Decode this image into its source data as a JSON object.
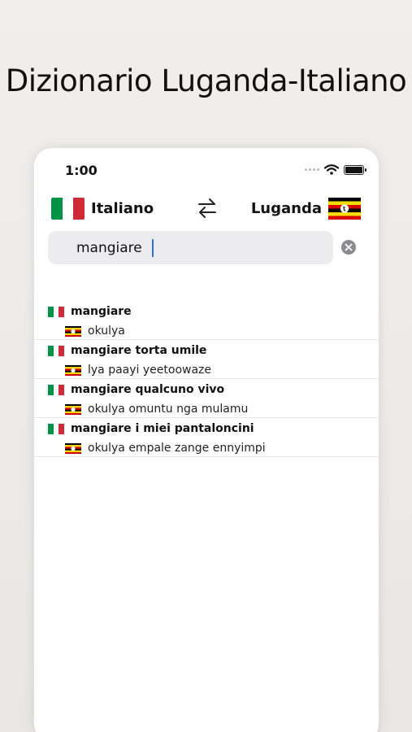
{
  "headline": "Dizionario Luganda-Italiano",
  "status_bar": {
    "time": "1:00"
  },
  "languages": {
    "source": "Italiano",
    "target": "Luganda"
  },
  "search": {
    "value": "mangiare"
  },
  "results": [
    {
      "term": "mangiare",
      "translation": "okulya"
    },
    {
      "term": "mangiare torta umile",
      "translation": "lya paayi yeetoowaze"
    },
    {
      "term": "mangiare qualcuno vivo",
      "translation": "okulya omuntu nga mulamu"
    },
    {
      "term": "mangiare i miei pantaloncini",
      "translation": "okulya empale zange ennyimpi"
    }
  ],
  "colors": {
    "italy_green": "#009246",
    "italy_white": "#ffffff",
    "italy_red": "#ce2b37",
    "uganda_black": "#000000",
    "uganda_yellow": "#fcdc04",
    "uganda_red": "#d90000",
    "caret": "#2f6fe0"
  },
  "icons": [
    "wifi-icon",
    "battery-icon",
    "swap-icon",
    "clear-icon",
    "italy-flag-icon",
    "uganda-flag-icon"
  ]
}
